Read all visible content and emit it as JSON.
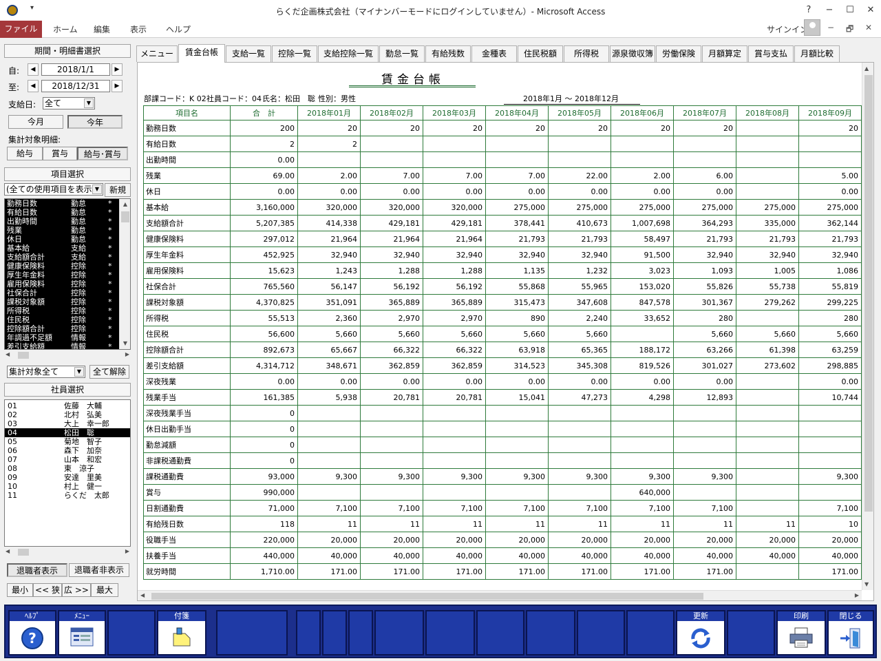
{
  "window": {
    "title": "らくだ企画株式会社（マイナンバーモードにログインしていません）- Microsoft Access",
    "min": "−",
    "max": "☐",
    "close": "✕",
    "help": "?"
  },
  "ribbon": {
    "tabs": [
      "ファイル",
      "ホーム",
      "編集",
      "表示",
      "ヘルプ"
    ],
    "signin": "サインイン"
  },
  "left": {
    "period_header": "期間・明細書選択",
    "from_label": "自:",
    "from_date": "2018/1/1",
    "to_label": "至:",
    "to_date": "2018/12/31",
    "payday_label": "支給日:",
    "payday_value": "全て",
    "this_month": "今月",
    "this_year": "今年",
    "target_label": "集計対象明細:",
    "target_btns": [
      "給与",
      "賞与",
      "給与･賞与"
    ],
    "item_header": "項目選択",
    "item_filter": "(全ての使用項目を表示)",
    "new_btn": "新規",
    "items": [
      [
        "勤務日数",
        "勤怠",
        "*"
      ],
      [
        "有給日数",
        "勤怠",
        "*"
      ],
      [
        "出勤時間",
        "勤怠",
        "*"
      ],
      [
        "残業",
        "勤怠",
        "*"
      ],
      [
        "休日",
        "勤怠",
        "*"
      ],
      [
        "基本給",
        "支給",
        "*"
      ],
      [
        "支給額合計",
        "支給",
        "*"
      ],
      [
        "健康保険料",
        "控除",
        "*"
      ],
      [
        "厚生年金料",
        "控除",
        "*"
      ],
      [
        "雇用保険料",
        "控除",
        "*"
      ],
      [
        "社保合計",
        "控除",
        "*"
      ],
      [
        "課税対象額",
        "控除",
        "*"
      ],
      [
        "所得税",
        "控除",
        "*"
      ],
      [
        "住民税",
        "控除",
        "*"
      ],
      [
        "控除額合計",
        "控除",
        "*"
      ],
      [
        "年調過不足額",
        "情報",
        "*"
      ],
      [
        "差引支給額",
        "情報",
        "*"
      ]
    ],
    "agg_filter": "集計対象全て",
    "clear_all": "全て解除",
    "emp_header": "社員選択",
    "employees": [
      [
        "01",
        "佐藤　大輔"
      ],
      [
        "02",
        "北村　弘美"
      ],
      [
        "03",
        "大上　幸一郎"
      ],
      [
        "04",
        "松田　聡"
      ],
      [
        "05",
        "菊地　智子"
      ],
      [
        "06",
        "森下　加奈"
      ],
      [
        "07",
        "山本　和宏"
      ],
      [
        "08",
        "東　涼子"
      ],
      [
        "09",
        "安達　里美"
      ],
      [
        "10",
        "村上　健一"
      ],
      [
        "11",
        "らくだ　太郎"
      ]
    ],
    "retired_show": "退職者表示",
    "retired_hide": "退職者非表示",
    "size_btns": [
      "最小",
      "<< 狭",
      "広 >>",
      "最大"
    ]
  },
  "tabs": [
    "メニュー",
    "賃金台帳",
    "支給一覧",
    "控除一覧",
    "支給控除一覧",
    "勤怠一覧",
    "有給残数",
    "金種表",
    "住民税額",
    "所得税",
    "源泉徴収簿",
    "労働保険",
    "月額算定",
    "賞与支払",
    "月額比較"
  ],
  "report": {
    "title": "賃金台帳",
    "dept": "部課コード：K 02",
    "emp_code": "社員コード：04",
    "emp_name": "氏名：松田　聡",
    "gender": "性別：男性",
    "period": "2018年1月 ～ 2018年12月",
    "headers": [
      "項目名",
      "合　計",
      "2018年01月",
      "2018年02月",
      "2018年03月",
      "2018年04月",
      "2018年05月",
      "2018年06月",
      "2018年07月",
      "2018年08月",
      "2018年09月"
    ],
    "rows": [
      [
        "勤務日数",
        "200",
        "20",
        "20",
        "20",
        "20",
        "20",
        "20",
        "20",
        "",
        "20"
      ],
      [
        "有給日数",
        "2",
        "2",
        "",
        "",
        "",
        "",
        "",
        "",
        "",
        ""
      ],
      [
        "出勤時間",
        "0.00",
        "",
        "",
        "",
        "",
        "",
        "",
        "",
        "",
        ""
      ],
      [
        "残業",
        "69.00",
        "2.00",
        "7.00",
        "7.00",
        "7.00",
        "22.00",
        "2.00",
        "6.00",
        "",
        "5.00"
      ],
      [
        "休日",
        "0.00",
        "0.00",
        "0.00",
        "0.00",
        "0.00",
        "0.00",
        "0.00",
        "0.00",
        "",
        "0.00"
      ],
      [
        "基本給",
        "3,160,000",
        "320,000",
        "320,000",
        "320,000",
        "275,000",
        "275,000",
        "275,000",
        "275,000",
        "275,000",
        "275,000"
      ],
      [
        "支給額合計",
        "5,207,385",
        "414,338",
        "429,181",
        "429,181",
        "378,441",
        "410,673",
        "1,007,698",
        "364,293",
        "335,000",
        "362,144"
      ],
      [
        "健康保険料",
        "297,012",
        "21,964",
        "21,964",
        "21,964",
        "21,793",
        "21,793",
        "58,497",
        "21,793",
        "21,793",
        "21,793"
      ],
      [
        "厚生年金料",
        "452,925",
        "32,940",
        "32,940",
        "32,940",
        "32,940",
        "32,940",
        "91,500",
        "32,940",
        "32,940",
        "32,940"
      ],
      [
        "雇用保険料",
        "15,623",
        "1,243",
        "1,288",
        "1,288",
        "1,135",
        "1,232",
        "3,023",
        "1,093",
        "1,005",
        "1,086"
      ],
      [
        "社保合計",
        "765,560",
        "56,147",
        "56,192",
        "56,192",
        "55,868",
        "55,965",
        "153,020",
        "55,826",
        "55,738",
        "55,819"
      ],
      [
        "課税対象額",
        "4,370,825",
        "351,091",
        "365,889",
        "365,889",
        "315,473",
        "347,608",
        "847,578",
        "301,367",
        "279,262",
        "299,225"
      ],
      [
        "所得税",
        "55,513",
        "2,360",
        "2,970",
        "2,970",
        "890",
        "2,240",
        "33,652",
        "280",
        "",
        "280"
      ],
      [
        "住民税",
        "56,600",
        "5,660",
        "5,660",
        "5,660",
        "5,660",
        "5,660",
        "",
        "5,660",
        "5,660",
        "5,660"
      ],
      [
        "控除額合計",
        "892,673",
        "65,667",
        "66,322",
        "66,322",
        "63,918",
        "65,365",
        "188,172",
        "63,266",
        "61,398",
        "63,259"
      ],
      [
        "差引支給額",
        "4,314,712",
        "348,671",
        "362,859",
        "362,859",
        "314,523",
        "345,308",
        "819,526",
        "301,027",
        "273,602",
        "298,885"
      ],
      [
        "深夜残業",
        "0.00",
        "0.00",
        "0.00",
        "0.00",
        "0.00",
        "0.00",
        "0.00",
        "0.00",
        "",
        "0.00"
      ],
      [
        "残業手当",
        "161,385",
        "5,938",
        "20,781",
        "20,781",
        "15,041",
        "47,273",
        "4,298",
        "12,893",
        "",
        "10,744"
      ],
      [
        "深夜残業手当",
        "0",
        "",
        "",
        "",
        "",
        "",
        "",
        "",
        "",
        ""
      ],
      [
        "休日出勤手当",
        "0",
        "",
        "",
        "",
        "",
        "",
        "",
        "",
        "",
        ""
      ],
      [
        "勤怠減額",
        "0",
        "",
        "",
        "",
        "",
        "",
        "",
        "",
        "",
        ""
      ],
      [
        "非課税通勤費",
        "0",
        "",
        "",
        "",
        "",
        "",
        "",
        "",
        "",
        ""
      ],
      [
        "課税通勤費",
        "93,000",
        "9,300",
        "9,300",
        "9,300",
        "9,300",
        "9,300",
        "9,300",
        "9,300",
        "",
        "9,300"
      ],
      [
        "賞与",
        "990,000",
        "",
        "",
        "",
        "",
        "",
        "640,000",
        "",
        "",
        ""
      ],
      [
        "日割通勤費",
        "71,000",
        "7,100",
        "7,100",
        "7,100",
        "7,100",
        "7,100",
        "7,100",
        "7,100",
        "",
        "7,100"
      ],
      [
        "有給残日数",
        "118",
        "11",
        "11",
        "11",
        "11",
        "11",
        "11",
        "11",
        "11",
        "10"
      ],
      [
        "役職手当",
        "220,000",
        "20,000",
        "20,000",
        "20,000",
        "20,000",
        "20,000",
        "20,000",
        "20,000",
        "20,000",
        "20,000"
      ],
      [
        "扶養手当",
        "440,000",
        "40,000",
        "40,000",
        "40,000",
        "40,000",
        "40,000",
        "40,000",
        "40,000",
        "40,000",
        "40,000"
      ],
      [
        "就労時間",
        "1,710.00",
        "171.00",
        "171.00",
        "171.00",
        "171.00",
        "171.00",
        "171.00",
        "171.00",
        "",
        "171.00"
      ]
    ]
  },
  "fkeys": {
    "help": "ﾍﾙﾌﾟ",
    "menu": "ﾒﾆｭｰ",
    "tag": "付箋",
    "refresh": "更新",
    "print": "印刷",
    "close": "閉じる"
  },
  "colors": {
    "file_tab": "#a4373a",
    "grid": "#2d7a3a",
    "fkey_bar": "#1c2f8c"
  }
}
